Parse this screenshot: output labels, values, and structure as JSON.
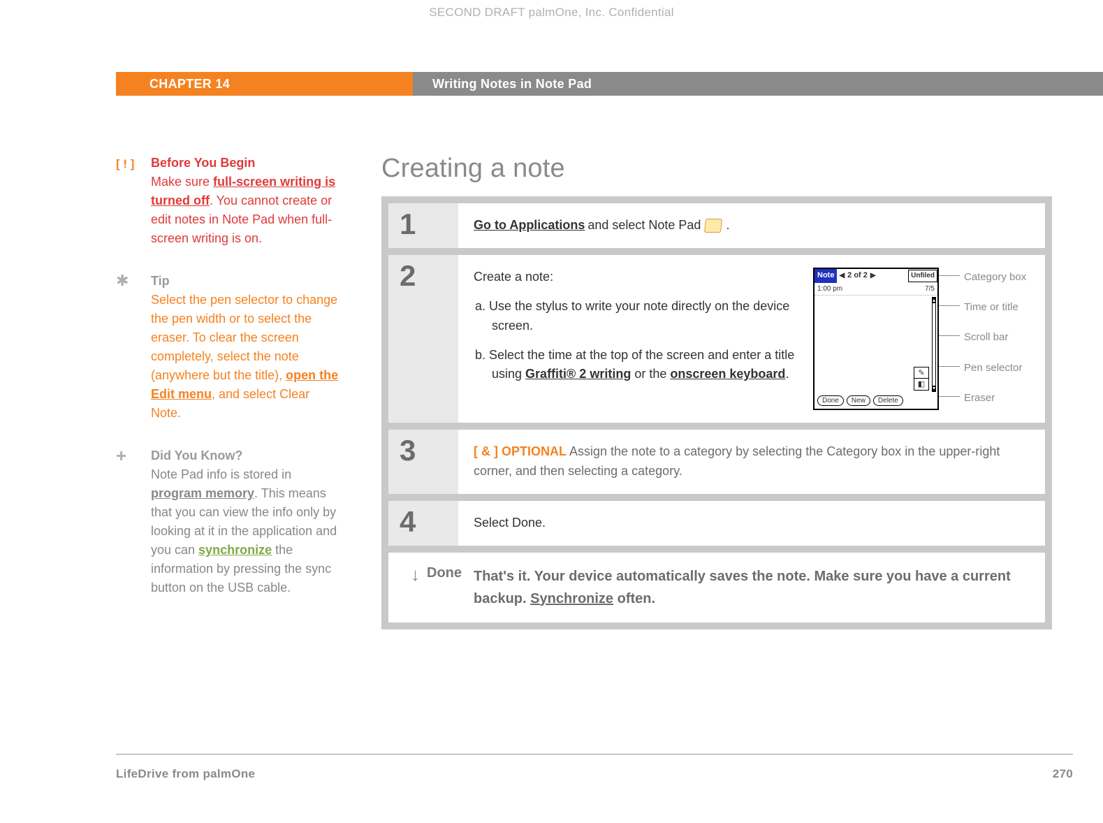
{
  "confidential": "SECOND DRAFT palmOne, Inc.  Confidential",
  "header": {
    "chapter": "CHAPTER 14",
    "title": "Writing Notes in Note Pad"
  },
  "sidebar": {
    "before": {
      "marker": "[ ! ]",
      "title": "Before You Begin",
      "pre": "Make sure ",
      "link": "full-screen writing is turned off",
      "post": ". You cannot create or edit notes in Note Pad when full-screen writing is on."
    },
    "tip": {
      "marker": "✱",
      "title": "Tip",
      "pre": "Select the pen selector to change the pen width or to select the eraser. To clear the screen completely, select the note (anywhere but the title), ",
      "link": "open the Edit menu",
      "post": ", and select Clear Note."
    },
    "dyk": {
      "marker": "+",
      "title": "Did You Know?",
      "t1": "Note Pad info is stored in ",
      "link1": "program memory",
      "t2": ". This means that you can view the info only by looking at it in the application and you can ",
      "link2": "synchronize",
      "t3": " the information by pressing the sync button on the USB cable."
    }
  },
  "main": {
    "section_title": "Creating a note",
    "step1": {
      "num": "1",
      "link": "Go to Applications",
      "rest_a": " and select Note Pad ",
      "rest_b": "."
    },
    "step2": {
      "num": "2",
      "lead": "Create a note:",
      "a_pre": "a.  Use the stylus to write your note directly on the device screen.",
      "b_t1": "b.  Select the time at the top of the screen and enter a title using ",
      "b_link1": "Graffiti® 2 writing",
      "b_mid": " or the ",
      "b_link2": "onscreen keyboard",
      "b_end": "."
    },
    "device": {
      "note_label": "Note",
      "counter": "2 of 2",
      "category": "Unfiled",
      "time": "1:00 pm",
      "date": "7/5",
      "btn_done": "Done",
      "btn_new": "New",
      "btn_delete": "Delete"
    },
    "callouts": {
      "c1": "Category box",
      "c2": "Time or title",
      "c3": "Scroll bar",
      "c4": "Pen selector",
      "c5": "Eraser"
    },
    "step3": {
      "num": "3",
      "tag": "[ & ] OPTIONAL",
      "text": "   Assign the note to a category by selecting the Category box in the upper-right corner, and then selecting a category."
    },
    "step4": {
      "num": "4",
      "text": "Select Done."
    },
    "done": {
      "label": "Done",
      "t1": "That's it. Your device automatically saves the note. Make sure you have a current backup. ",
      "link": "Synchronize",
      "t2": " often."
    }
  },
  "footer": {
    "left": "LifeDrive from palmOne",
    "right": "270"
  }
}
